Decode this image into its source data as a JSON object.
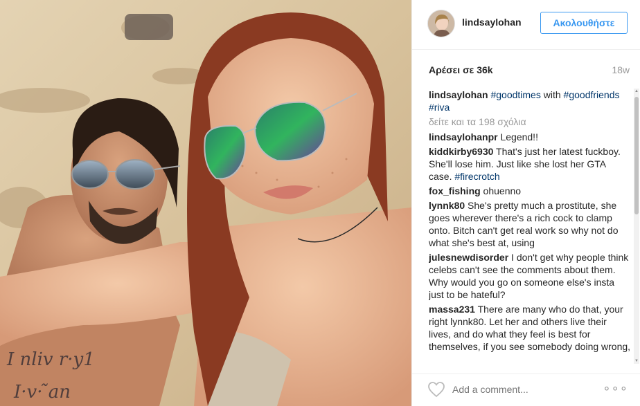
{
  "post": {
    "username": "lindsaylohan",
    "follow_label": "Ακολουθήστε",
    "likes": "Αρέσει σε 36k",
    "time": "18w",
    "caption": {
      "user": "lindsaylohan",
      "tag1": "#goodtimes",
      "text1": " with",
      "tag2": "#goodfriends",
      "tag3": "#riva"
    },
    "view_all": "δείτε και τα 198 σχόλια",
    "comments": [
      {
        "user": "lindsaylohanpr",
        "text": " Legend!!"
      },
      {
        "user": "kiddkirby6930",
        "text": " That's just her latest fuckboy. She'll lose him. Just like she lost her GTA case. ",
        "tag": "#firecrotch"
      },
      {
        "user": "fox_fishing",
        "text": " ohuenno"
      },
      {
        "user": "lynnk80",
        "text": " She's pretty much a prostitute, she goes wherever there's a rich cock to clamp onto. Bitch can't get real work so why not do what she's best at, using"
      },
      {
        "user": "julesnewdisorder",
        "text": " I don't get why people think celebs can't see the comments about them. Why would you go on someone else's insta just to be hateful?"
      },
      {
        "user": "massa231",
        "text": " There are many who do that, your right lynnk80. Let her and others live their lives, and do what they feel is best for themselves, if you see somebody doing wrong,"
      }
    ],
    "add_comment_placeholder": "Add a comment...",
    "more_label": "∘∘∘"
  },
  "icons": {
    "heart": "heart-icon",
    "more": "more-options-icon",
    "avatar": "avatar"
  },
  "colors": {
    "link": "#003569",
    "follow": "#3897f0",
    "muted": "#999999"
  }
}
